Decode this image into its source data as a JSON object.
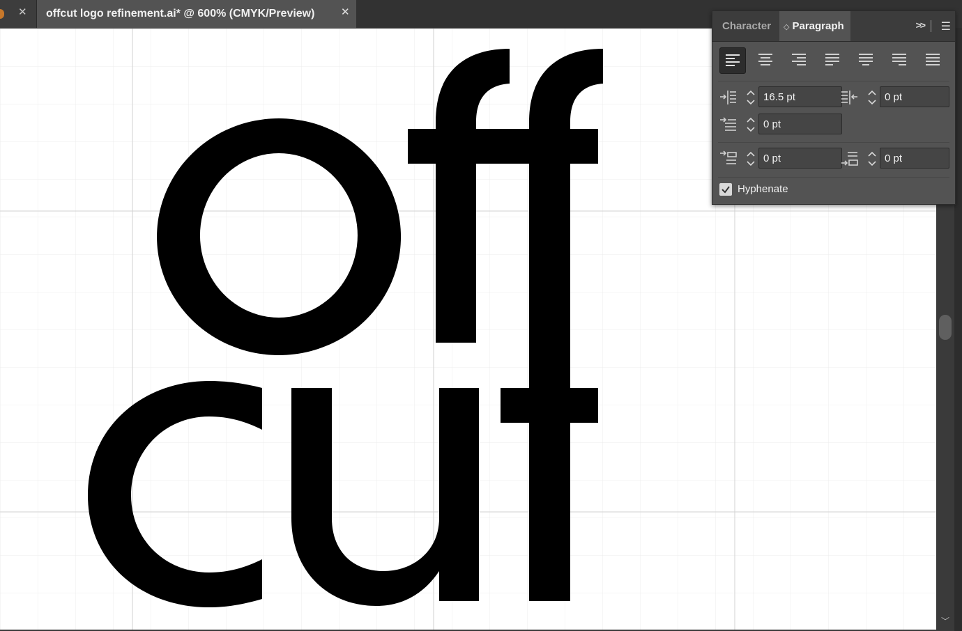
{
  "document_tab": {
    "title": "offcut logo refinement.ai* @ 600% (CMYK/Preview)",
    "close_glyph": "✕"
  },
  "previous_tab": {
    "close_glyph": "✕"
  },
  "artwork": {
    "line1": "off",
    "line2": "cut",
    "fill_color": "#000000"
  },
  "paragraph_panel": {
    "tabs": [
      {
        "label": "Character",
        "active": false
      },
      {
        "label": "Paragraph",
        "active": true
      }
    ],
    "expand_glyph": ">>",
    "alignment_buttons": [
      {
        "name": "align-left",
        "active": true
      },
      {
        "name": "align-center",
        "active": false
      },
      {
        "name": "align-right",
        "active": false
      },
      {
        "name": "justify-last-left",
        "active": false
      },
      {
        "name": "justify-last-center",
        "active": false
      },
      {
        "name": "justify-last-right",
        "active": false
      },
      {
        "name": "justify-all",
        "active": false
      }
    ],
    "left_indent": "16.5 pt",
    "right_indent": "0 pt",
    "first_line_indent": "0 pt",
    "space_before": "0 pt",
    "space_after": "0 pt",
    "hyphenate": {
      "label": "Hyphenate",
      "checked": true
    }
  },
  "colors": {
    "ui_background": "#535353",
    "panel_tab_bar": "#3c3c3c",
    "canvas": "#ffffff",
    "grid": "#e6e6e6",
    "accent_tab": "#c8782a"
  }
}
